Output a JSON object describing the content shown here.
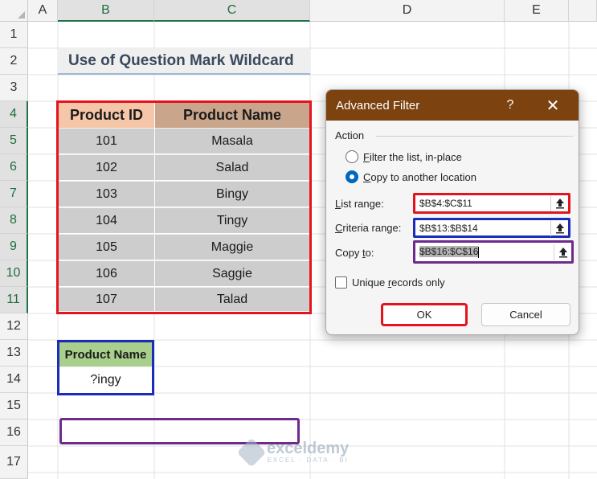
{
  "columns": [
    "A",
    "B",
    "C",
    "D",
    "E"
  ],
  "rows": [
    "1",
    "2",
    "3",
    "4",
    "5",
    "6",
    "7",
    "8",
    "9",
    "10",
    "11",
    "12",
    "13",
    "14",
    "15",
    "16",
    "17"
  ],
  "sheet": {
    "title": "Use of Question Mark Wildcard",
    "table": {
      "headers": [
        "Product ID",
        "Product Name"
      ],
      "rows": [
        [
          "101",
          "Masala"
        ],
        [
          "102",
          "Salad"
        ],
        [
          "103",
          "Bingy"
        ],
        [
          "104",
          "Tingy"
        ],
        [
          "105",
          "Maggie"
        ],
        [
          "106",
          "Saggie"
        ],
        [
          "107",
          "Talad"
        ]
      ]
    },
    "criteria": {
      "header": "Product Name",
      "value": "?ingy"
    }
  },
  "dialog": {
    "title": "Advanced Filter",
    "help_icon": "?",
    "close_icon": "✕",
    "action_label": "Action",
    "radio_filter_in_place": {
      "underlined": "F",
      "rest": "ilter the list, in-place",
      "selected": false
    },
    "radio_copy_to_location": {
      "underlined": "C",
      "rest": "opy to another location",
      "selected": true
    },
    "list_range": {
      "underlined": "L",
      "rest": "ist range:",
      "value": "$B$4:$C$11"
    },
    "criteria_range": {
      "underlined": "C",
      "rest": "riteria range:",
      "value": "$B$13:$B$14"
    },
    "copy_to": {
      "prefix": "Copy ",
      "underlined": "t",
      "rest": "o:",
      "value": "$B$16:$C$16"
    },
    "unique_records": {
      "prefix": "Unique ",
      "underlined": "r",
      "rest": "ecords only",
      "checked": false
    },
    "ok_label": "OK",
    "cancel_label": "Cancel"
  },
  "watermark": {
    "name": "exceldemy",
    "tagline": "EXCEL · DATA · BI"
  },
  "colors": {
    "dialog_titlebar": "#7c4210",
    "table_border": "#e3141e",
    "criteria_border": "#1c2cb8",
    "output_border": "#6f2b8c",
    "header_id_fill": "#f6c6a8",
    "header_name_fill": "#c9a58c",
    "criteria_header_fill": "#a9cf8c"
  }
}
